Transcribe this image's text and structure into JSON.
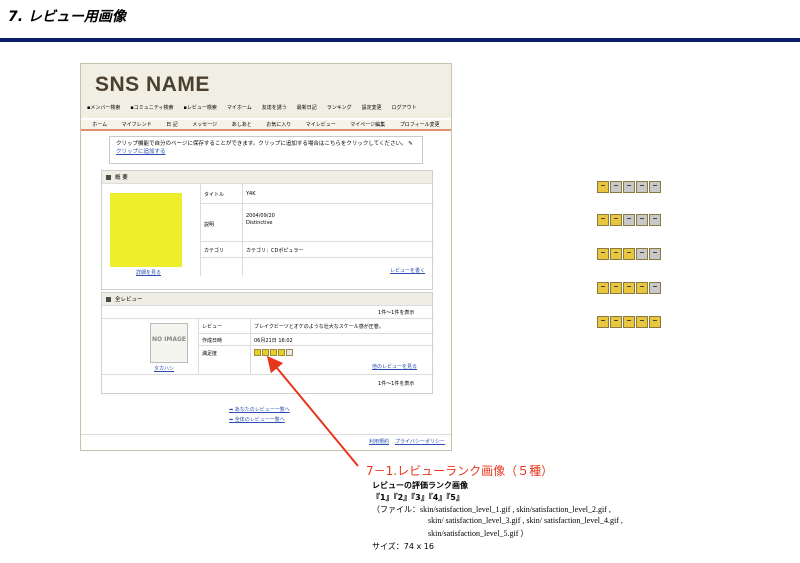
{
  "page": {
    "title": "7. レビュー用画像"
  },
  "mock": {
    "logo": "SNS NAME",
    "subnav": [
      "▪メンバー検索",
      "▪コミュニティ検索",
      "▪レビュー検索",
      "マイホーム",
      "友達を誘う",
      "最新日記",
      "ランキング",
      "設定変更",
      "ログアウト"
    ],
    "tabs": [
      "ホーム",
      "マイフレンド",
      "日 記",
      "メッセージ",
      "あしあと",
      "お気に入り",
      "マイレビュー",
      "マイページ編集",
      "プロフィール変更"
    ],
    "clip": {
      "text": "クリップ機能で自分のページに保存することができます。クリップに追加する場合はこちらをクリックしてください。",
      "link": "クリップに追加する"
    },
    "overview": {
      "heading": "概 要",
      "title_label": "タイトル",
      "title_value": "Y4K",
      "desc_label": "説明",
      "desc_value_1": "2004/09/20",
      "desc_value_2": "Distinctive",
      "category_label": "カテゴリ",
      "category_value": "カテゴリ：CDポピュラー",
      "detail_link": "詳細を見る",
      "write_link": "レビューを書く"
    },
    "reviews": {
      "heading": "全レビュー",
      "count_top": "1件～1件を表示",
      "noimage": "NO IMAGE",
      "user": "タカハシ",
      "review_label": "レビュー",
      "review_value": "ブレイクビーツとオケのような壮大なスケール感が圧巻。",
      "date_label": "作成日時",
      "date_value": "06月21日 16:02",
      "sat_label": "満足度",
      "sat_rank": 4,
      "other_link": "他のレビューを見る",
      "count_bottom": "1件～1件を表示"
    },
    "footer_links": [
      "あなたのレビュー一覧へ",
      "全体のレビュー一覧へ"
    ],
    "bottom_links": [
      "利用規約",
      "プライバシーポリシー"
    ],
    "star_color": "#e8d020"
  },
  "rank_samples": [
    1,
    2,
    3,
    4,
    5
  ],
  "rank_colors": {
    "filled": "#e8c640",
    "empty": "#c8c8c8"
  },
  "annotation": {
    "title": "7－1.レビューランク画像（５種）",
    "line1": "レビューの評価ランク画像",
    "line2": "『1』『2』『3』『4』『5』",
    "line3": "（ファイル：skin/satisfaction_level_1.gif , skin/satisfaction_level_2.gif ,",
    "line4": "skin/ satisfaction_level_3.gif , skin/ satisfaction_level_4.gif ,",
    "line5": "skin/satisfaction_level_5.gif ）",
    "line6": "サイズ：74 x 16"
  }
}
